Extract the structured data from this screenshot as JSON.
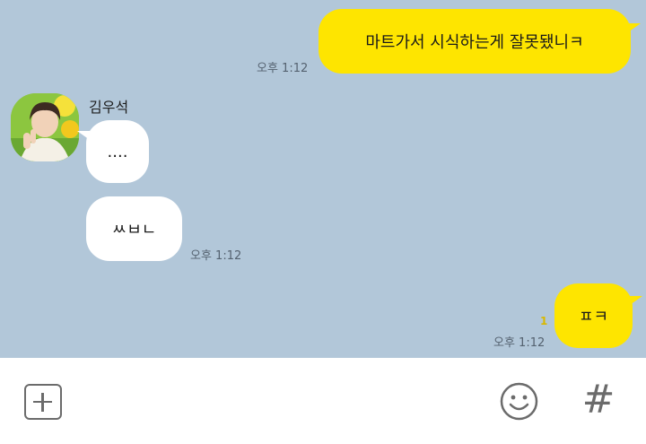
{
  "chat": {
    "messages": [
      {
        "sender": "me",
        "text": "마트가서 시식하는게 잘못됐니ㅋ",
        "time": "오후 1:12"
      },
      {
        "sender": "김우석",
        "text": "....",
        "time": ""
      },
      {
        "sender": "김우석",
        "text": "ㅆㅂㄴ",
        "time": "오후 1:12"
      },
      {
        "sender": "me",
        "text": "ㅍㅋ",
        "time": "오후 1:12",
        "unread": "1"
      }
    ],
    "contact_name": "김우석"
  },
  "input_bar": {
    "plus_icon": "plus-square-icon",
    "emoji_icon": "smiley-icon",
    "hash_icon": "hash-icon",
    "hash_label": "#"
  },
  "colors": {
    "background": "#b2c7d9",
    "my_bubble": "#fee500",
    "their_bubble": "#ffffff"
  }
}
